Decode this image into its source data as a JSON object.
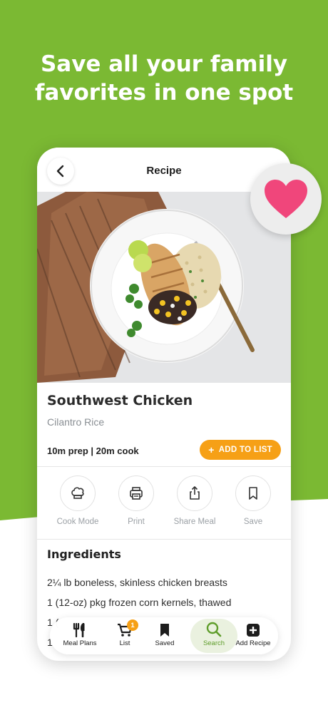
{
  "headline": {
    "line1": "Save all your family",
    "line2": "favorites in one spot"
  },
  "colors": {
    "brand_green": "#7bb933",
    "accent_orange": "#f6a016",
    "heart_pink": "#f0467b"
  },
  "screen": {
    "title": "Recipe",
    "back_icon": "chevron-left-icon"
  },
  "recipe": {
    "title": "Southwest Chicken",
    "subtitle": "Cilantro Rice",
    "times": "10m prep | 20m cook",
    "add_to_list": "ADD TO LIST"
  },
  "actions": [
    {
      "label": "Cook Mode",
      "icon": "chef-hat-icon"
    },
    {
      "label": "Print",
      "icon": "printer-icon"
    },
    {
      "label": "Share Meal",
      "icon": "share-icon"
    },
    {
      "label": "Save",
      "icon": "bookmark-icon"
    }
  ],
  "ingredients": {
    "title": "Ingredients",
    "items": [
      "2¼ lb boneless, skinless chicken breasts",
      "1 (12-oz) pkg frozen corn kernels, thawed",
      "1 (",
      "1"
    ]
  },
  "tabbar": {
    "tabs": [
      {
        "label": "Meal Plans",
        "icon": "utensils-icon"
      },
      {
        "label": "List",
        "icon": "cart-icon",
        "badge": "1"
      },
      {
        "label": "Saved",
        "icon": "bookmark-icon"
      },
      {
        "label": "Search",
        "icon": "search-icon",
        "active": true
      },
      {
        "label": "Add Recipe",
        "icon": "plus-square-icon"
      }
    ]
  },
  "favorite": {
    "icon": "heart-icon"
  }
}
